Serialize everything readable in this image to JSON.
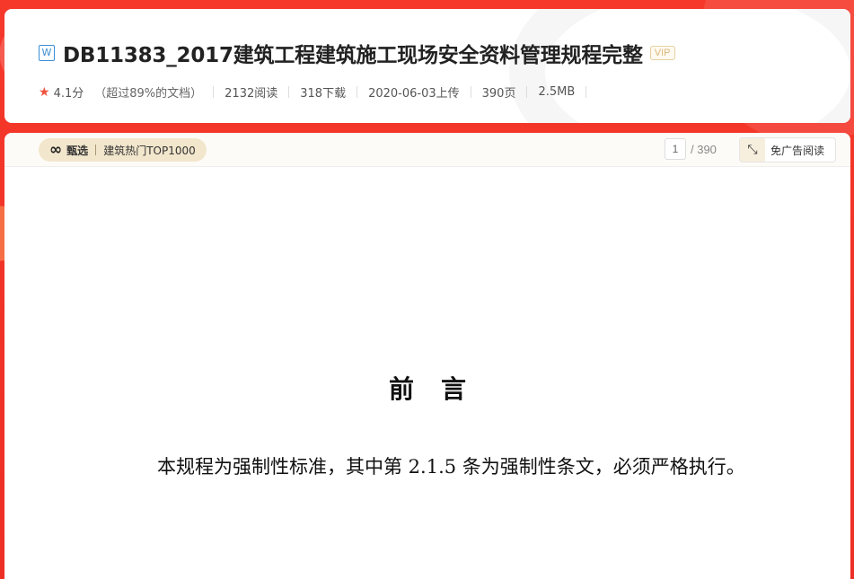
{
  "header": {
    "doc_type_icon": "word-icon",
    "title": "DB11383_2017建筑工程建筑施工现场安全资料管理规程完整",
    "vip_label": "VIP",
    "meta": {
      "rating": "4.1分",
      "beat_text": "（超过89%的文档）",
      "reads": "2132阅读",
      "downloads": "318下载",
      "upload_date": "2020-06-03上传",
      "pages": "390页",
      "size": "2.5MB"
    }
  },
  "toolbar": {
    "select_brand": "甄选",
    "select_tag": "建筑热门TOP1000",
    "current_page": "1",
    "total_pages": "/ 390",
    "ad_free_label": "免广告阅读"
  },
  "document": {
    "heading": "前言",
    "paragraphs": [
      "本规程为强制性标准，其中第 2.1.5 条为强制性条文，必须严格执行。"
    ]
  },
  "colors": {
    "background_red": "#f23d2c",
    "accent_gold": "#f2e6cc",
    "star": "#f0533f"
  }
}
